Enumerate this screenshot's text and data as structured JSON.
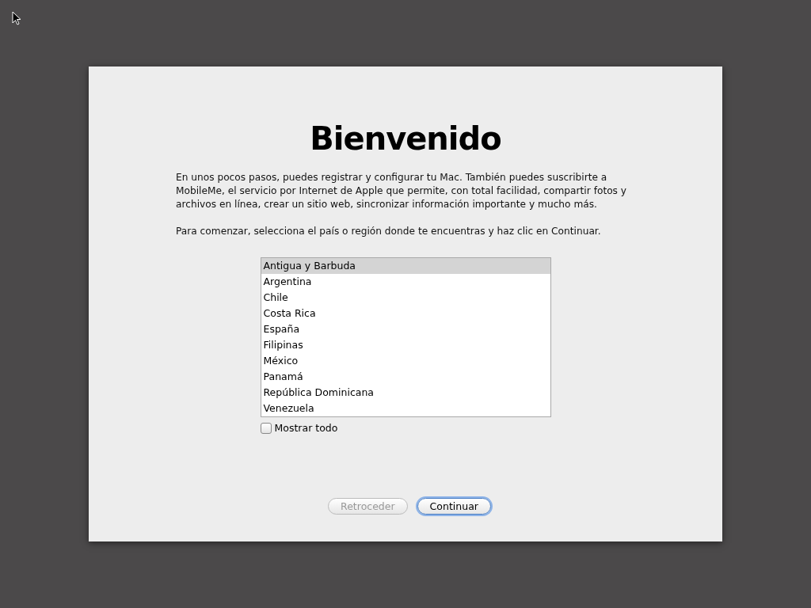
{
  "title": "Bienvenido",
  "paragraphs": [
    "En unos pocos pasos, puedes registrar y configurar tu Mac. También puedes suscribirte a MobileMe, el servicio por Internet de Apple que permite, con total facilidad, compartir fotos y archivos en línea, crear un sitio web, sincronizar información importante y mucho más.",
    "Para comenzar, selecciona el país o región donde te encuentras y haz clic en Continuar."
  ],
  "countries": [
    {
      "label": "Antigua y Barbuda",
      "selected": true
    },
    {
      "label": "Argentina",
      "selected": false
    },
    {
      "label": "Chile",
      "selected": false
    },
    {
      "label": "Costa Rica",
      "selected": false
    },
    {
      "label": "España",
      "selected": false
    },
    {
      "label": "Filipinas",
      "selected": false
    },
    {
      "label": "México",
      "selected": false
    },
    {
      "label": "Panamá",
      "selected": false
    },
    {
      "label": "República Dominicana",
      "selected": false
    },
    {
      "label": "Venezuela",
      "selected": false
    }
  ],
  "show_all": {
    "label": "Mostrar todo",
    "checked": false
  },
  "buttons": [
    {
      "label": "Retroceder",
      "disabled": true,
      "default": false
    },
    {
      "label": "Continuar",
      "disabled": false,
      "default": true
    }
  ]
}
